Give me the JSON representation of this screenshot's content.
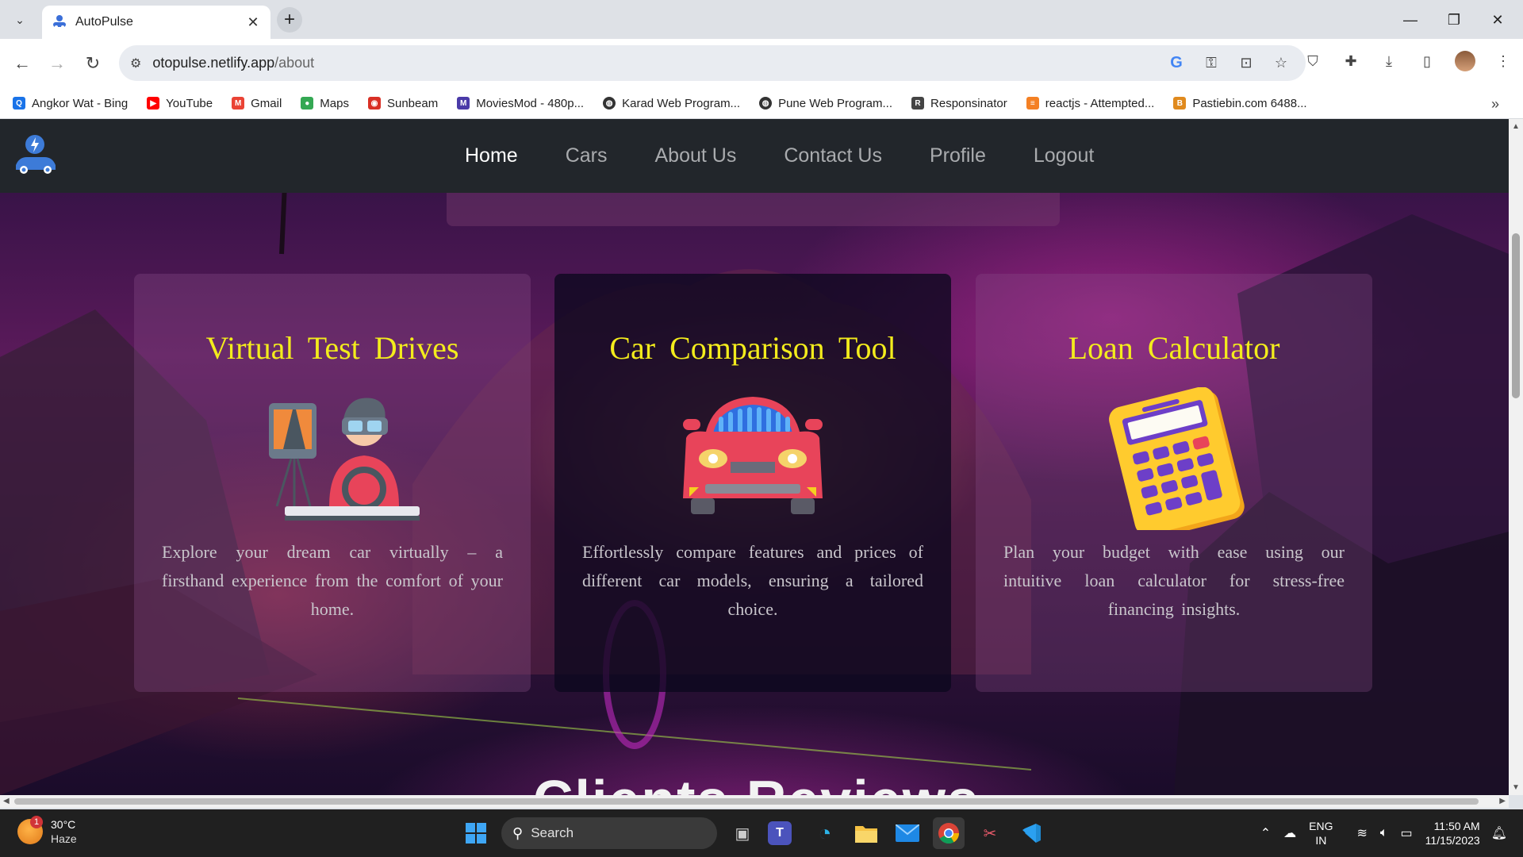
{
  "browser": {
    "tab_title": "AutoPulse",
    "url_host": "otopulse.netlify.app",
    "url_path": "/about",
    "bookmarks": [
      {
        "label": "Angkor Wat - Bing",
        "color": "#1a73e8",
        "icon": "bing-search-icon"
      },
      {
        "label": "YouTube",
        "color": "#ff0000",
        "icon": "youtube-icon"
      },
      {
        "label": "Gmail",
        "color": "#ea4335",
        "icon": "gmail-icon"
      },
      {
        "label": "Maps",
        "color": "#34a853",
        "icon": "maps-pin-icon"
      },
      {
        "label": "Sunbeam",
        "color": "#d93025",
        "icon": "sunbeam-icon"
      },
      {
        "label": "MoviesMod - 480p...",
        "color": "#4a3aa8",
        "icon": "moviesmod-icon"
      },
      {
        "label": "Karad Web Program...",
        "color": "#333333",
        "icon": "globe-icon"
      },
      {
        "label": "Pune Web Program...",
        "color": "#333333",
        "icon": "globe-icon"
      },
      {
        "label": "Responsinator",
        "color": "#444444",
        "icon": "responsinator-icon"
      },
      {
        "label": "reactjs - Attempted...",
        "color": "#f48024",
        "icon": "stackoverflow-icon"
      },
      {
        "label": "Pastiebin.com 6488...",
        "color": "#e08a1e",
        "icon": "pastebin-icon"
      }
    ]
  },
  "site": {
    "nav": [
      {
        "label": "Home",
        "active": true
      },
      {
        "label": "Cars",
        "active": false
      },
      {
        "label": "About Us",
        "active": false
      },
      {
        "label": "Contact Us",
        "active": false
      },
      {
        "label": "Profile",
        "active": false
      },
      {
        "label": "Logout",
        "active": false
      }
    ],
    "cards": [
      {
        "title": "Virtual Test Drives",
        "icon": "vr-driver-icon",
        "description": "Explore your dream car virtually – a firsthand experience from the comfort of your home."
      },
      {
        "title": "Car Comparison Tool",
        "icon": "red-car-icon",
        "description": "Effortlessly compare features and prices of different car models, ensuring a tailored choice."
      },
      {
        "title": "Loan Calculator",
        "icon": "calculator-icon",
        "description": "Plan your budget with ease using our intuitive loan calculator for stress-free financing insights."
      }
    ],
    "next_heading": "Clients Reviews",
    "colors": {
      "title_yellow": "#f3ec1c",
      "navbar": "#22262b"
    }
  },
  "taskbar": {
    "weather_temp": "30°C",
    "weather_cond": "Haze",
    "weather_badge": "1",
    "search_label": "Search",
    "lang_top": "ENG",
    "lang_bottom": "IN",
    "time": "11:50 AM",
    "date": "11/15/2023"
  }
}
